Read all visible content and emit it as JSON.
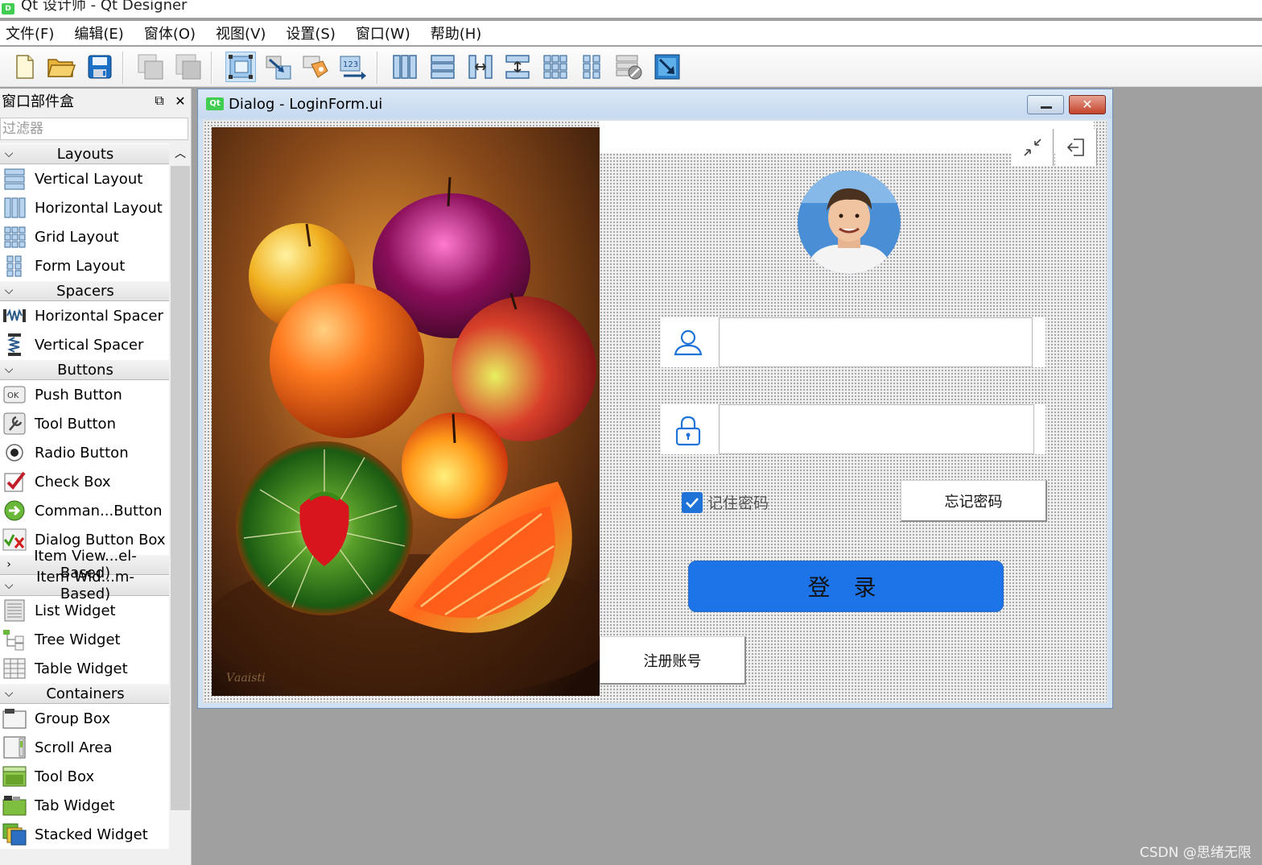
{
  "window": {
    "title": "Qt 设计师 - Qt Designer"
  },
  "menu": [
    "文件(F)",
    "编辑(E)",
    "窗体(O)",
    "视图(V)",
    "设置(S)",
    "窗口(W)",
    "帮助(H)"
  ],
  "toolbar": {
    "icons": [
      "new-file-icon",
      "open-folder-icon",
      "save-icon",
      "copy-window-icon",
      "paste-window-icon",
      "edit-widgets-icon",
      "edit-signals-slots-icon",
      "edit-buddies-icon",
      "edit-tab-order-icon",
      "layout-horizontal-icon",
      "layout-vertical-icon",
      "layout-horizontal-splitter-icon",
      "layout-vertical-splitter-icon",
      "layout-grid-icon",
      "layout-form-icon",
      "break-layout-icon",
      "adjust-size-icon"
    ]
  },
  "widget_box": {
    "title": "窗口部件盒",
    "filter_placeholder": "过滤器",
    "categories": [
      {
        "label": "Layouts",
        "expanded": true,
        "items": [
          "Vertical Layout",
          "Horizontal Layout",
          "Grid Layout",
          "Form Layout"
        ]
      },
      {
        "label": "Spacers",
        "expanded": true,
        "items": [
          "Horizontal Spacer",
          "Vertical Spacer"
        ]
      },
      {
        "label": "Buttons",
        "expanded": true,
        "items": [
          "Push Button",
          "Tool Button",
          "Radio Button",
          "Check Box",
          "Comman...Button",
          "Dialog Button Box"
        ]
      },
      {
        "label": "Item View...el-Based)",
        "expanded": false,
        "items": []
      },
      {
        "label": "Item Wid...m-Based)",
        "expanded": true,
        "items": [
          "List Widget",
          "Tree Widget",
          "Table Widget"
        ]
      },
      {
        "label": "Containers",
        "expanded": true,
        "items": [
          "Group Box",
          "Scroll Area",
          "Tool Box",
          "Tab Widget",
          "Stacked Widget"
        ]
      }
    ]
  },
  "form": {
    "title": "Dialog - LoginForm.ui",
    "username_value": "",
    "password_value": "",
    "remember_label": "记住密码",
    "remember_checked": true,
    "forgot_label": "忘记密码",
    "login_label": "登 录",
    "register_label": "注册账号",
    "accent_color": "#1c74e8"
  },
  "watermark": "CSDN @思绪无限"
}
